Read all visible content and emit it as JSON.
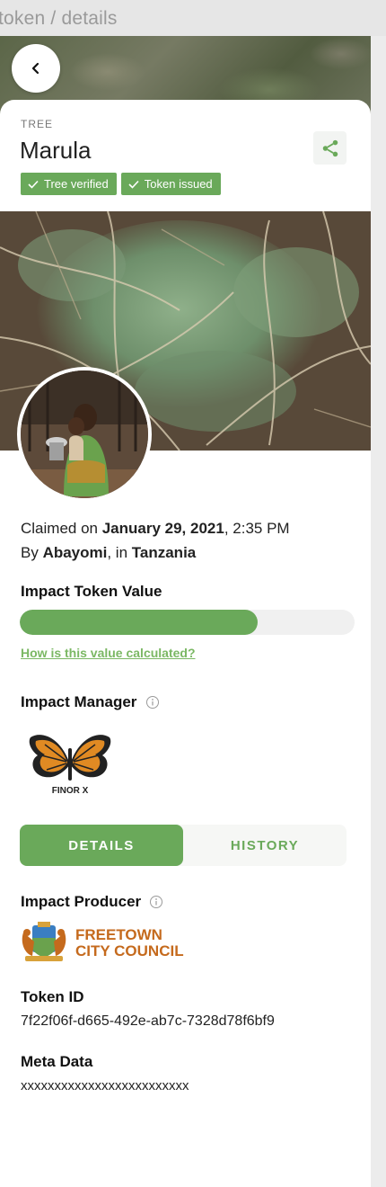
{
  "breadcrumb": "token / details",
  "asset": {
    "type_label": "TREE",
    "name": "Marula"
  },
  "badges": [
    {
      "label": "Tree verified",
      "icon": "check-icon"
    },
    {
      "label": "Token issued",
      "icon": "check-icon"
    }
  ],
  "claim": {
    "prefix": "Claimed on ",
    "date": "January 29, 2021",
    "time": ", 2:35 PM",
    "by_prefix": "By ",
    "claimer": "Abayomi",
    "in_prefix": ", in ",
    "country": "Tanzania"
  },
  "impact_token": {
    "title": "Impact Token Value",
    "progress_fraction": 0.71,
    "link_label": "How is this value calculated?"
  },
  "impact_manager": {
    "title": "Impact Manager",
    "logo_text": "FINOR X"
  },
  "tabs": [
    {
      "label": "DETAILS",
      "active": true
    },
    {
      "label": "HISTORY",
      "active": false
    }
  ],
  "details": {
    "producer_title": "Impact Producer",
    "producer_logo_line1": "FREETOWN",
    "producer_logo_line2": "CITY COUNCIL",
    "token_id_title": "Token ID",
    "token_id": "7f22f06f-d665-492e-ab7c-7328d78f6bf9",
    "meta_title": "Meta Data",
    "meta_value": "xxxxxxxxxxxxxxxxxxxxxxxxx"
  },
  "colors": {
    "accent": "#6aa95a",
    "link": "#7bb864",
    "freetown_orange": "#c56a1d"
  }
}
